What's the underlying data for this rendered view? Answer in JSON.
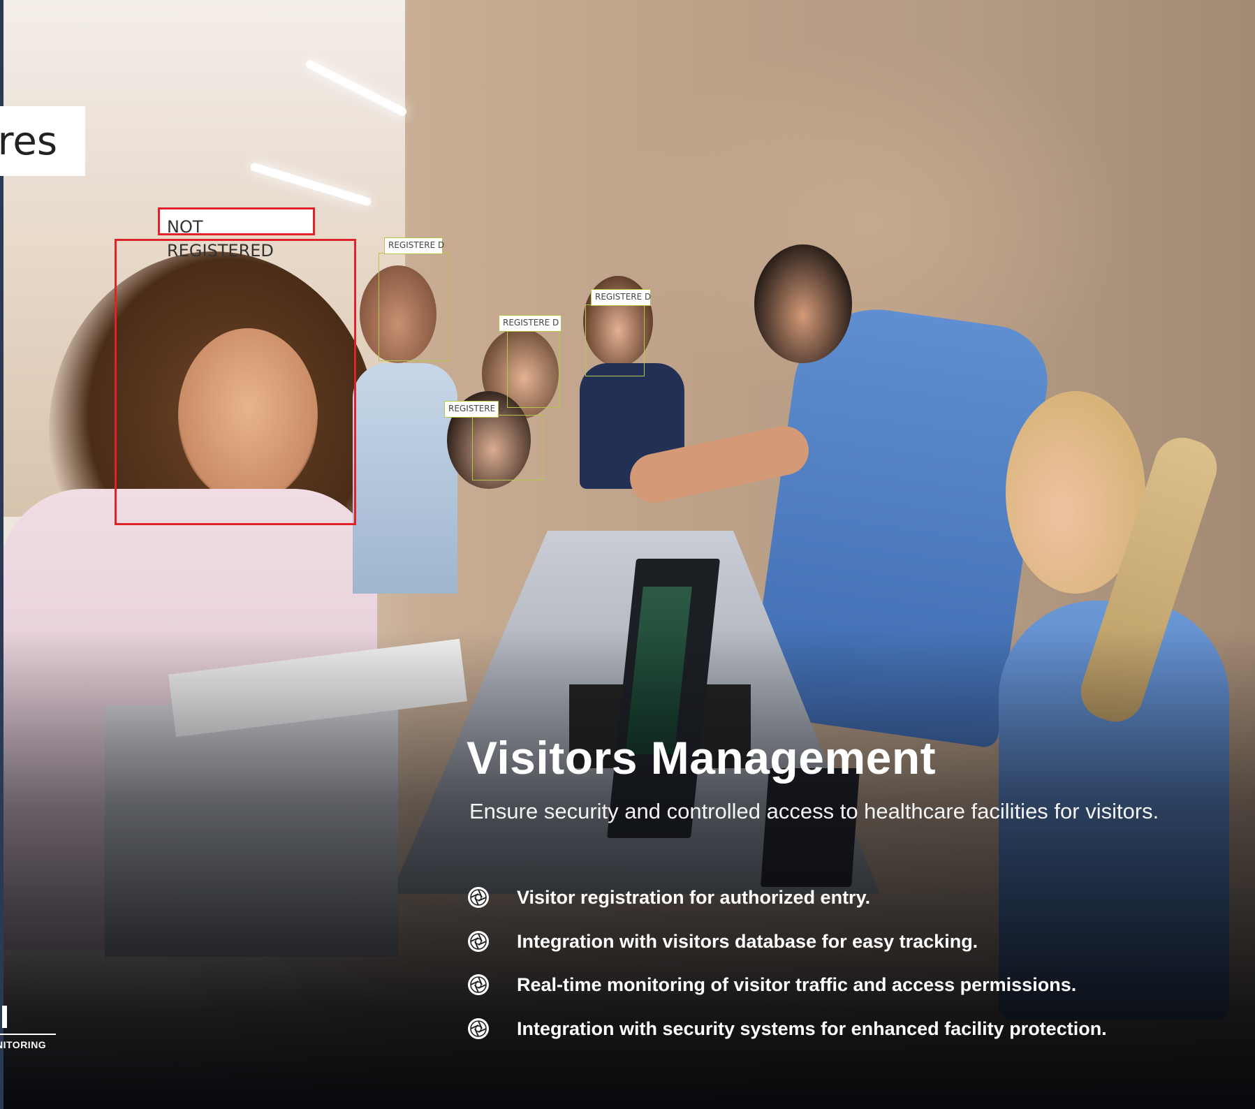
{
  "title_card": {
    "text": "res"
  },
  "detections": {
    "not_registered": "NOT REGISTERED",
    "registered": [
      "REGISTERE D",
      "REGISTERE D",
      "REGISTERE D",
      "REGISTERE D"
    ]
  },
  "logo": {
    "text": "NITORING"
  },
  "section": {
    "title": "Visitors Management",
    "subtitle": "Ensure security and controlled access to healthcare facilities for visitors.",
    "features": [
      "Visitor registration for authorized entry.",
      "Integration with visitors database for easy tracking.",
      "Real-time monitoring of visitor traffic and access permissions.",
      "Integration with security systems for enhanced facility protection."
    ]
  },
  "colors": {
    "alert_red": "#e0222b",
    "registered_green": "#b7c44a",
    "text_white": "#ffffff"
  },
  "icons": [
    "aperture-icon",
    "aperture-icon",
    "aperture-icon",
    "aperture-icon"
  ]
}
